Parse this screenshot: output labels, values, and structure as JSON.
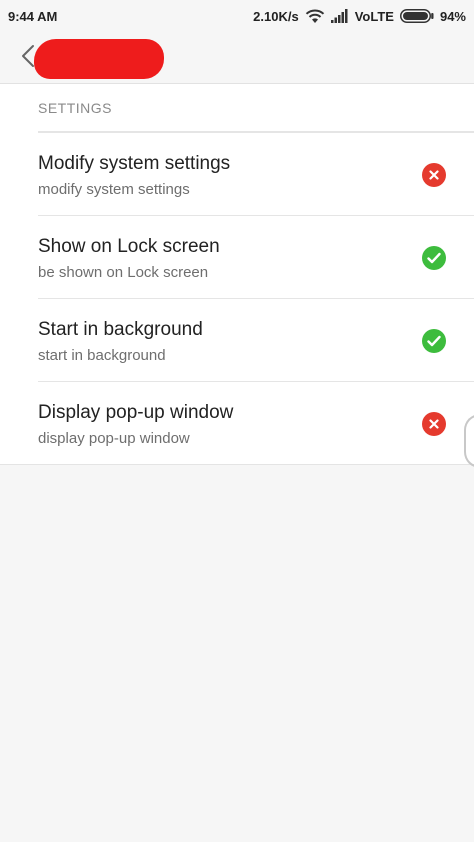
{
  "status_bar": {
    "time": "9:44 AM",
    "network_speed": "2.10K/s",
    "network_type": "VoLTE",
    "battery": "94%",
    "icons": [
      "wifi-icon",
      "signal-icon",
      "battery-icon"
    ]
  },
  "header": {
    "back_icon": "chevron-left-icon",
    "title_redacted": true,
    "redaction_color": "#ee1c1c"
  },
  "section": {
    "title": "SETTINGS"
  },
  "permissions": [
    {
      "title": "Modify system settings",
      "subtitle": "modify system settings",
      "status": "denied"
    },
    {
      "title": "Show on Lock screen",
      "subtitle": "be shown on Lock screen",
      "status": "allowed"
    },
    {
      "title": "Start in background",
      "subtitle": "start in background",
      "status": "allowed"
    },
    {
      "title": "Display pop-up window",
      "subtitle": "display pop-up window",
      "status": "denied"
    }
  ],
  "colors": {
    "denied": "#e53a2e",
    "allowed": "#3dbc3d",
    "background": "#f6f6f6"
  }
}
